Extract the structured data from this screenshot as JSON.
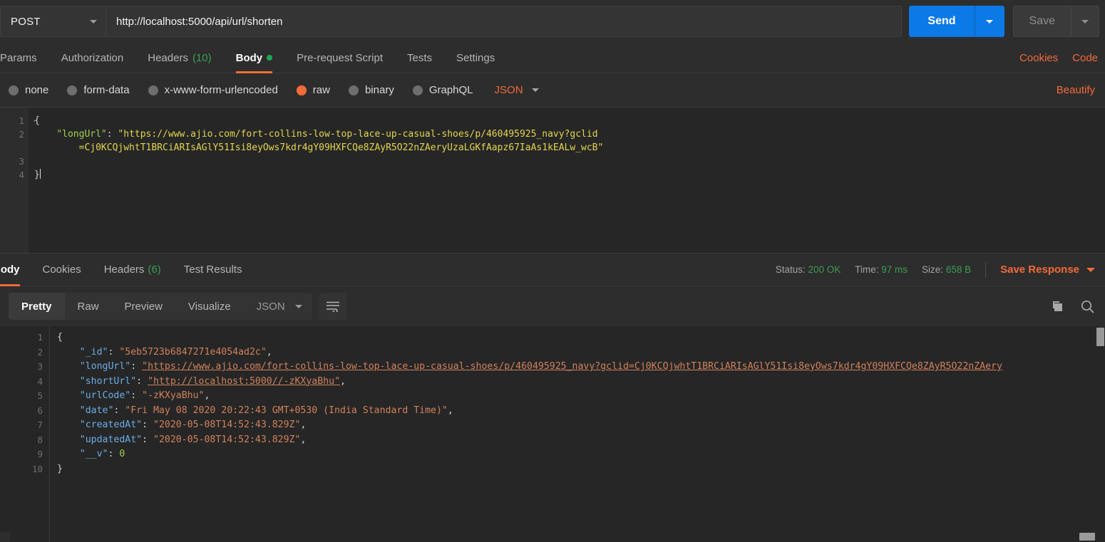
{
  "request": {
    "method": "POST",
    "url": "http://localhost:5000/api/url/shorten",
    "send_label": "Send",
    "save_label": "Save",
    "tabs": [
      {
        "label": "Params",
        "count": "",
        "active": false
      },
      {
        "label": "Authorization",
        "count": "",
        "active": false
      },
      {
        "label": "Headers",
        "count": "(10)",
        "active": false
      },
      {
        "label": "Body",
        "count": "",
        "active": true
      },
      {
        "label": "Pre-request Script",
        "count": "",
        "active": false
      },
      {
        "label": "Tests",
        "count": "",
        "active": false
      },
      {
        "label": "Settings",
        "count": "",
        "active": false
      }
    ],
    "links": [
      {
        "label": "Cookies"
      },
      {
        "label": "Code"
      }
    ],
    "body_types": [
      {
        "label": "none",
        "selected": false
      },
      {
        "label": "form-data",
        "selected": false
      },
      {
        "label": "x-www-form-urlencoded",
        "selected": false
      },
      {
        "label": "raw",
        "selected": true
      },
      {
        "label": "binary",
        "selected": false
      },
      {
        "label": "GraphQL",
        "selected": false
      }
    ],
    "format": "JSON",
    "beautify_label": "Beautify",
    "editor": {
      "line_numbers": [
        "1",
        "2",
        "3",
        "4"
      ],
      "open_brace": "{",
      "close_brace": "}",
      "key": "\"longUrl\"",
      "colon": ": ",
      "value_line1": "\"https://www.ajio.com/fort-collins-low-top-lace-up-casual-shoes/p/460495925_navy?gclid",
      "value_line2": "=Cj0KCQjwhtT1BRCiARIsAGlY51Isi8eyOws7kdr4gY09HXFCQe8ZAyR5O22nZAeryUzaLGKfAapz67IaAs1kEALw_wcB\""
    }
  },
  "response": {
    "tabs": [
      {
        "label": "Body",
        "count": "",
        "active": true
      },
      {
        "label": "Cookies",
        "count": "",
        "active": false
      },
      {
        "label": "Headers",
        "count": "(6)",
        "active": false
      },
      {
        "label": "Test Results",
        "count": "",
        "active": false
      }
    ],
    "status_label": "Status:",
    "status_value": "200 OK",
    "time_label": "Time:",
    "time_value": "97 ms",
    "size_label": "Size:",
    "size_value": "658 B",
    "save_response_label": "Save Response",
    "view_modes": [
      {
        "label": "Pretty",
        "active": true
      },
      {
        "label": "Raw",
        "active": false
      },
      {
        "label": "Preview",
        "active": false
      },
      {
        "label": "Visualize",
        "active": false
      }
    ],
    "format": "JSON",
    "line_numbers": [
      "1",
      "2",
      "3",
      "4",
      "5",
      "6",
      "7",
      "8",
      "9",
      "10"
    ],
    "json": {
      "open_brace": "{",
      "close_brace": "}",
      "entries": [
        {
          "key": "\"_id\"",
          "value": "\"5eb5723b6847271e4054ad2c\"",
          "type": "string",
          "comma": ",",
          "url": false
        },
        {
          "key": "\"longUrl\"",
          "value": "\"https://www.ajio.com/fort-collins-low-top-lace-up-casual-shoes/p/460495925_navy?gclid=Cj0KCQjwhtT1BRCiARIsAGlY51Isi8eyOws7kdr4gY09HXFCQe8ZAyR5O22nZAery",
          "type": "string",
          "comma": "",
          "url": true
        },
        {
          "key": "\"shortUrl\"",
          "value": "\"http://localhost:5000//-zKXyaBhu\"",
          "type": "string",
          "comma": ",",
          "url": true
        },
        {
          "key": "\"urlCode\"",
          "value": "\"-zKXyaBhu\"",
          "type": "string",
          "comma": ",",
          "url": false
        },
        {
          "key": "\"date\"",
          "value": "\"Fri May 08 2020 20:22:43 GMT+0530 (India Standard Time)\"",
          "type": "string",
          "comma": ",",
          "url": false
        },
        {
          "key": "\"createdAt\"",
          "value": "\"2020-05-08T14:52:43.829Z\"",
          "type": "string",
          "comma": ",",
          "url": false
        },
        {
          "key": "\"updatedAt\"",
          "value": "\"2020-05-08T14:52:43.829Z\"",
          "type": "string",
          "comma": ",",
          "url": false
        },
        {
          "key": "\"__v\"",
          "value": "0",
          "type": "number",
          "comma": "",
          "url": false
        }
      ]
    }
  },
  "icons": {
    "copy": "copy-icon",
    "search": "search-icon",
    "wrap": "wrap-lines-icon"
  },
  "colors": {
    "accent_blue": "#0b79e6",
    "accent_orange": "#f26b3a",
    "success_green": "#3d9c52",
    "bg": "#2d2d2d",
    "editor_bg": "#262626"
  }
}
